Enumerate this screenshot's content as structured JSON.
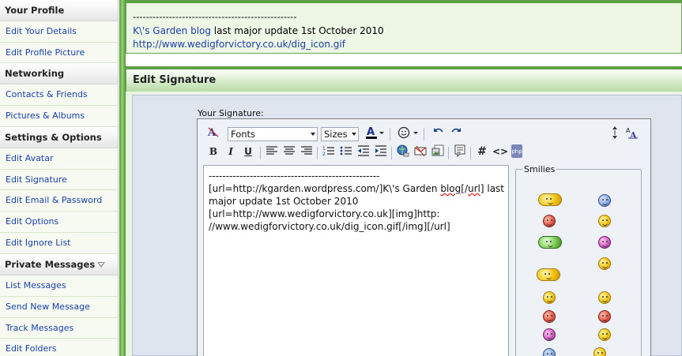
{
  "sidebar": {
    "sections": [
      {
        "title": "Your Profile",
        "items": [
          "Edit Your Details",
          "Edit Profile Picture"
        ]
      },
      {
        "title": "Networking",
        "items": [
          "Contacts & Friends",
          "Pictures & Albums"
        ]
      },
      {
        "title": "Settings & Options",
        "items": [
          "Edit Avatar",
          "Edit Signature",
          "Edit Email & Password",
          "Edit Options",
          "Edit Ignore List"
        ]
      },
      {
        "title": "Private Messages",
        "items": [
          "List Messages",
          "Send New Message",
          "Track Messages",
          "Edit Folders"
        ]
      }
    ]
  },
  "preview": {
    "dashes": "--------------------------------------------------",
    "blog_link": "K\\'s Garden blog",
    "blog_suffix": " last major update 1st October 2010",
    "url": "http://www.wedigforvictory.co.uk/dig_icon.gif"
  },
  "panel": {
    "title": "Edit Signature",
    "signature_label": "Your Signature:"
  },
  "toolbar": {
    "fonts_label": "Fonts",
    "sizes_label": "Sizes",
    "bold": "B",
    "italic": "I",
    "underline": "U",
    "hash": "#",
    "code": "<>",
    "php": "php"
  },
  "editor": {
    "lines": [
      "--------------------------------------------------",
      "[url=http://kgarden.wordpress.com/]K\\'s Garden ",
      "blog",
      "[/",
      "url",
      "] last",
      "major update 1st October 2010",
      " [url=http://www.wedigforvictory.co.uk][img]http:",
      "//www.wedigforvictory.co.uk/dig_icon.gif[/img][/url]"
    ]
  },
  "smilies": {
    "legend": "Smilies"
  },
  "colors": {
    "accent_green": "#5ca043",
    "link_blue": "#1a3fa8"
  }
}
